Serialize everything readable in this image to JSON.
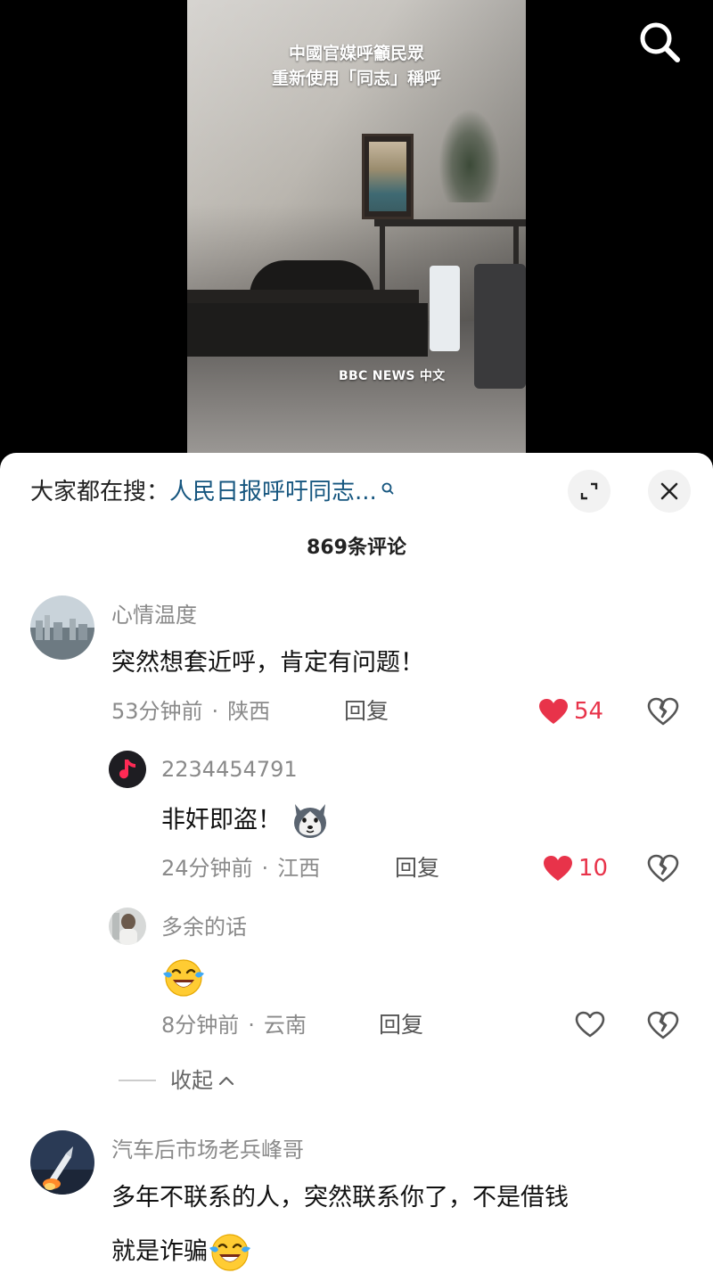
{
  "video": {
    "caption_line1": "中國官媒呼籲民眾",
    "caption_line2": "重新使用「同志」稱呼",
    "watermark": "BBC NEWS 中文",
    "search_icon": "search-icon"
  },
  "sheet": {
    "search_prefix": "大家都在搜：",
    "search_query": "人民日报呼吁同志...",
    "comment_count": "869条评论",
    "expand_icon": "expand-icon",
    "close_icon": "close-icon"
  },
  "comments": [
    {
      "user": "心情温度",
      "text": "突然想套近呼，肯定有问题！",
      "time": "53分钟前",
      "location": "陕西",
      "reply": "回复",
      "likes": "54",
      "liked": true
    },
    {
      "user": "2234454791",
      "text": "非奸即盗！",
      "emoji": "husky-emoji",
      "time": "24分钟前",
      "location": "江西",
      "reply": "回复",
      "likes": "10",
      "liked": true
    },
    {
      "user": "多余的话",
      "emoji": "crying-laughing-emoji",
      "time": "8分钟前",
      "location": "云南",
      "reply": "回复",
      "liked": false
    },
    {
      "user": "汽车后市场老兵峰哥",
      "text_line1": "多年不联系的人，突然联系你了，不是借钱",
      "text_line2": "就是诈骗",
      "emoji": "crying-laughing-emoji"
    }
  ],
  "collapse_label": "收起",
  "colors": {
    "like_red": "#e8334a",
    "link_blue": "#16567f",
    "muted_gray": "#8a8a8a"
  }
}
